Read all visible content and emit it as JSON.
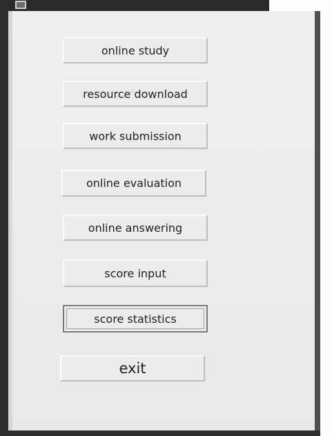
{
  "window": {
    "title_icon": "app-window-icon"
  },
  "menu": {
    "items": [
      {
        "label": "online study"
      },
      {
        "label": "resource download"
      },
      {
        "label": "work submission"
      },
      {
        "label": "online evaluation"
      },
      {
        "label": "online answering"
      },
      {
        "label": "score input"
      },
      {
        "label": "score statistics"
      },
      {
        "label": "exit"
      }
    ]
  }
}
